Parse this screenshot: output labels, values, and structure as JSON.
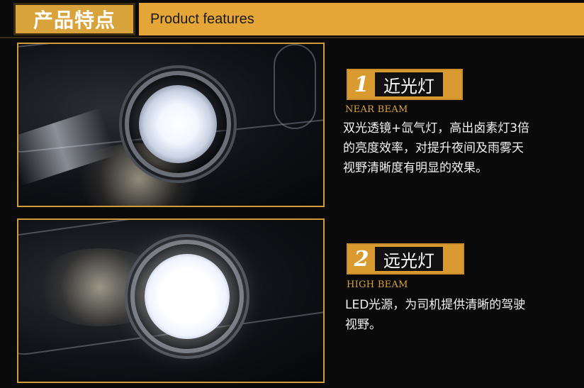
{
  "header": {
    "title_cn": "产品特点",
    "title_en": "Product features"
  },
  "features": [
    {
      "number": "1",
      "title": "近光灯",
      "subtitle_en": "NEAR BEAM",
      "description_lines": [
        "双光透镜+氙气灯，高出卤素灯3倍",
        "的亮度效率，对提升夜间及雨雾天",
        "视野清晰度有明显的效果。"
      ]
    },
    {
      "number": "2",
      "title": "远光灯",
      "subtitle_en": "HIGH BEAM",
      "description_lines": [
        "LED光源，为司机提供清晰的驾驶",
        "视野。"
      ]
    }
  ],
  "colors": {
    "accent": "#d9a33b",
    "background": "#0a0a0a",
    "badge_text_bg": "#111111"
  }
}
